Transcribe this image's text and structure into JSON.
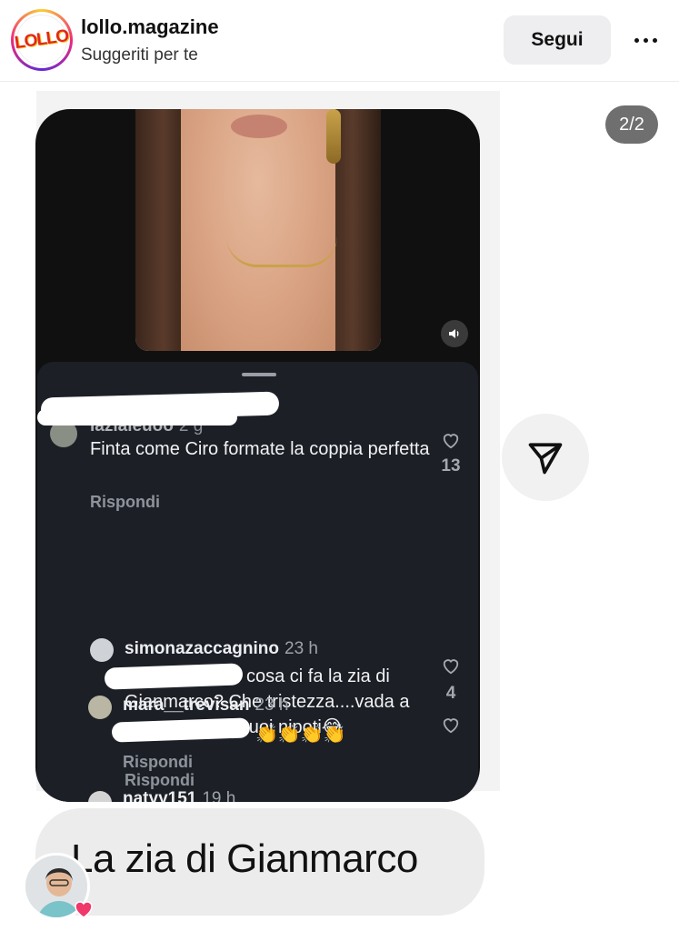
{
  "header": {
    "logo_text": "LOLLO",
    "username": "lollo.magazine",
    "subtitle": "Suggeriti per te",
    "follow_label": "Segui"
  },
  "carousel": {
    "counter": "2/2"
  },
  "comments": [
    {
      "username": "lazialeuoo",
      "time": "2 g",
      "text": "Finta come Ciro formate la coppia perfetta",
      "reply_label": "Rispondi",
      "likes": "13"
    },
    {
      "username": "simonazaccagnino",
      "time": "23 h",
      "text": "cosa ci fa la zia di Gianmarco? Che tristezza....vada a commentare i suoi nipoti😂",
      "reply_label": "Rispondi",
      "likes": "4"
    },
    {
      "username": "mara__trevisan",
      "time": "23 h",
      "text": "👏👏👏👏",
      "reply_label": "Rispondi",
      "likes": ""
    },
    {
      "username": "natyy151",
      "time": "19 h"
    }
  ],
  "caption": "La zia di Gianmarco",
  "icons": {
    "more": "more-horizontal-icon",
    "sound": "speaker-icon",
    "like": "heart-outline-icon",
    "share": "send-icon",
    "reaction": "heart-filled-icon"
  },
  "colors": {
    "sheet_bg": "#1c1f26",
    "follow_bg": "#eeeef0",
    "counter_bg": "#6f6f6f",
    "caption_bg": "#ececed",
    "heart_badge": "#f0386b"
  }
}
